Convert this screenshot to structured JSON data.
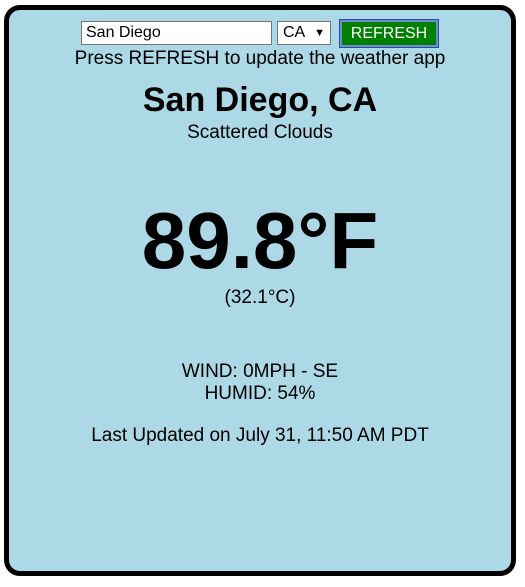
{
  "controls": {
    "city_value": "San Diego",
    "state_value": "CA",
    "refresh_label": "REFRESH"
  },
  "hint": "Press REFRESH to update the weather app",
  "weather": {
    "location": "San Diego, CA",
    "condition": "Scattered Clouds",
    "temp_f": "89.8°F",
    "temp_c": "(32.1°C)",
    "wind": "WIND: 0MPH - SE",
    "humid": "HUMID: 54%",
    "updated": "Last Updated on July 31, 11:50 AM PDT"
  },
  "colors": {
    "panel_background": "#add8e6",
    "button_background": "#008000",
    "button_text": "#ffffff"
  }
}
